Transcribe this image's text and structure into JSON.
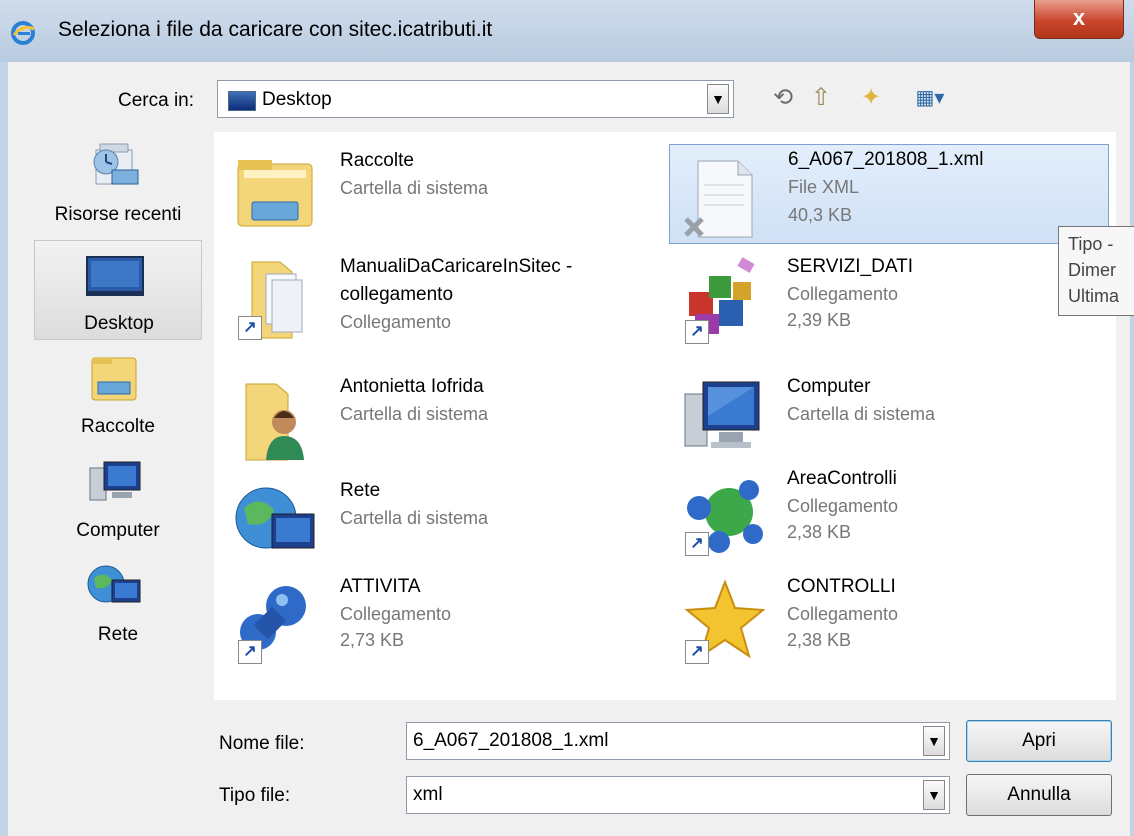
{
  "window": {
    "title": "Seleziona i file da caricare con sitec.icatributi.it",
    "close_label": "x"
  },
  "lookin": {
    "label": "Cerca in:",
    "value": "Desktop"
  },
  "toolbar": {
    "back_glyph": "⟲",
    "up_glyph": "⇧",
    "newfolder_glyph": "✦",
    "view_glyph": "▦▾"
  },
  "places": [
    {
      "label": "Risorse recenti",
      "icon": "recent-places-icon"
    },
    {
      "label": "Desktop",
      "icon": "desktop-icon",
      "active": true
    },
    {
      "label": "Raccolte",
      "icon": "libraries-icon"
    },
    {
      "label": "Computer",
      "icon": "computer-icon"
    },
    {
      "label": "Rete",
      "icon": "network-icon"
    }
  ],
  "files": [
    {
      "name": "Raccolte",
      "type": "Cartella di sistema",
      "icon": "libraries-folder-icon"
    },
    {
      "name": "6_A067_201808_1.xml",
      "type": "File XML",
      "size": "40,3 KB",
      "icon": "xml-file-icon",
      "selected": true
    },
    {
      "name": "ManualiDaCaricareInSitec -",
      "name2": "collegamento",
      "type": "Collegamento",
      "icon": "folder-shortcut-icon",
      "shortcut": true
    },
    {
      "name": "SERVIZI_DATI",
      "type": "Collegamento",
      "size": "2,39 KB",
      "icon": "blocks-app-icon",
      "shortcut": true
    },
    {
      "name": "Antonietta Iofrida",
      "type": "Cartella di sistema",
      "icon": "user-folder-icon"
    },
    {
      "name": "Computer",
      "type": "Cartella di sistema",
      "icon": "computer-icon"
    },
    {
      "name": "Rete",
      "type": "Cartella di sistema",
      "icon": "network-globe-icon"
    },
    {
      "name": "AreaControlli",
      "type": "Collegamento",
      "size": "2,38 KB",
      "icon": "molecule-icon",
      "shortcut": true
    },
    {
      "name": "ATTIVITA",
      "type": "Collegamento",
      "size": "2,73 KB",
      "icon": "pushpin-icon",
      "shortcut": true
    },
    {
      "name": "CONTROLLI",
      "type": "Collegamento",
      "size": "2,38 KB",
      "icon": "star-icon",
      "shortcut": true
    }
  ],
  "tooltip": {
    "lines": [
      "Tipo -",
      "Dimer",
      "Ultima"
    ]
  },
  "filename": {
    "label": "Nome file:",
    "value": "6_A067_201808_1.xml"
  },
  "filetype": {
    "label": "Tipo file:",
    "value": "xml"
  },
  "buttons": {
    "open": "Apri",
    "cancel": "Annulla"
  },
  "shortcut_glyph": "↗",
  "dropdown_glyph": "▼",
  "colors": {
    "selection": "#cfe1f6",
    "selection_border": "#7da2ce",
    "close_button": "#c9452d"
  }
}
